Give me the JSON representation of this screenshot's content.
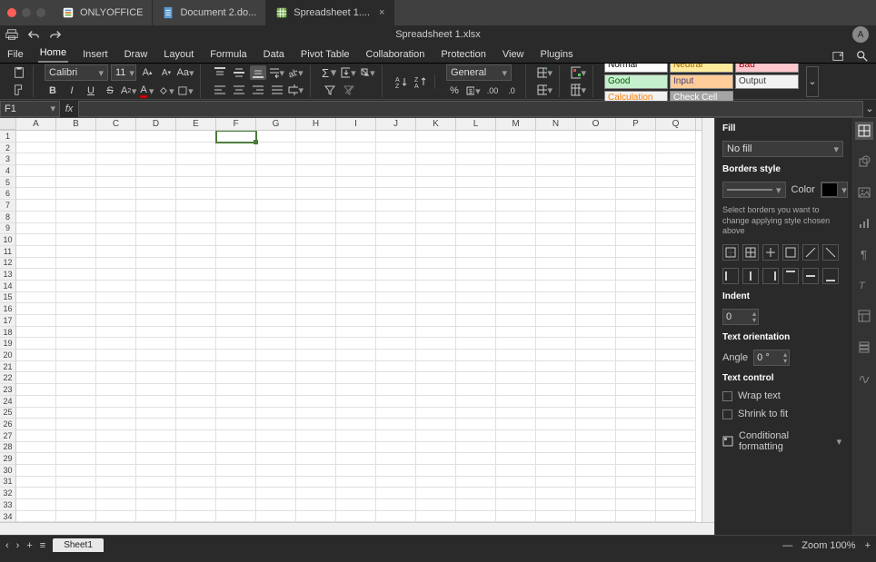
{
  "app": {
    "name": "ONLYOFFICE"
  },
  "tabs": [
    {
      "label": "ONLYOFFICE",
      "type": "app"
    },
    {
      "label": "Document 2.do...",
      "type": "doc"
    },
    {
      "label": "Spreadsheet 1....",
      "type": "sheet",
      "active": true
    }
  ],
  "doc_title": "Spreadsheet 1.xlsx",
  "avatar_initial": "A",
  "menu": {
    "items": [
      "File",
      "Home",
      "Insert",
      "Draw",
      "Layout",
      "Formula",
      "Data",
      "Pivot Table",
      "Collaboration",
      "Protection",
      "View",
      "Plugins"
    ],
    "active": "Home"
  },
  "ribbon": {
    "font_name": "Calibri",
    "font_size": "11",
    "number_format": "General",
    "styles": [
      {
        "label": "Normal",
        "bg": "#ffffff",
        "fg": "#000"
      },
      {
        "label": "Neutral",
        "bg": "#ffeb9c",
        "fg": "#9c6500"
      },
      {
        "label": "Bad",
        "bg": "#ffc7ce",
        "fg": "#9c0006"
      },
      {
        "label": "Good",
        "bg": "#c6efce",
        "fg": "#006100"
      },
      {
        "label": "Input",
        "bg": "#ffcc99",
        "fg": "#3f3f76"
      },
      {
        "label": "Output",
        "bg": "#f2f2f2",
        "fg": "#3f3f3f"
      },
      {
        "label": "Calculation",
        "bg": "#f2f2f2",
        "fg": "#fa7d00"
      },
      {
        "label": "Check Cell",
        "bg": "#a5a5a5",
        "fg": "#ffffff"
      }
    ]
  },
  "cell_ref": "F1",
  "columns": [
    "A",
    "B",
    "C",
    "D",
    "E",
    "F",
    "G",
    "H",
    "I",
    "J",
    "K",
    "L",
    "M",
    "N",
    "O",
    "P",
    "Q"
  ],
  "row_count": 35,
  "selected": {
    "col": 5,
    "row": 0
  },
  "panel": {
    "fill_label": "Fill",
    "fill_value": "No fill",
    "borders_label": "Borders style",
    "color_label": "Color",
    "borders_hint": "Select borders you want to change applying style chosen above",
    "indent_label": "Indent",
    "indent_value": "0",
    "orient_label": "Text orientation",
    "angle_label": "Angle",
    "angle_value": "0 °",
    "textctrl_label": "Text control",
    "wrap_label": "Wrap text",
    "shrink_label": "Shrink to fit",
    "cond_label": "Conditional formatting"
  },
  "status": {
    "sheet_name": "Sheet1",
    "zoom_label": "Zoom 100%"
  }
}
